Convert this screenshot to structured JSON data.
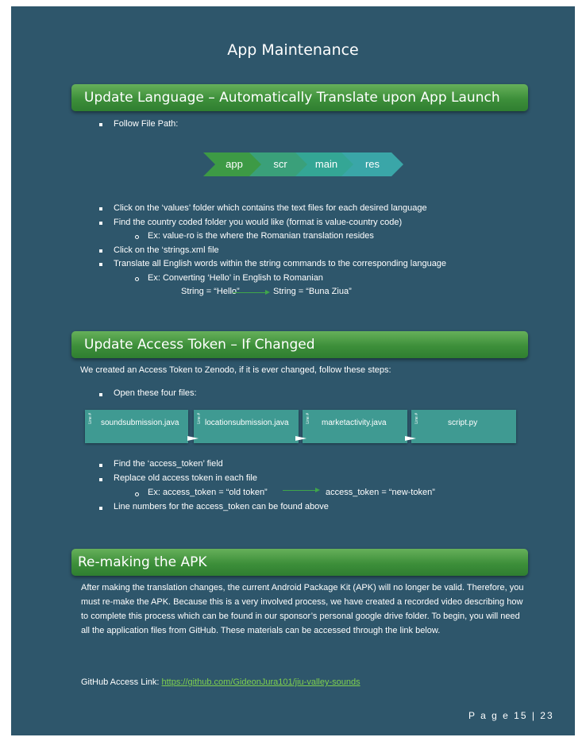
{
  "title": "App Maintenance",
  "section1": {
    "heading": "Update Language – Automatically Translate upon App Launch",
    "follow": "Follow File Path:",
    "path": [
      "app",
      "scr",
      "main",
      "res"
    ],
    "bullets": [
      "Click on the ‘values’ folder which contains the text files for each desired language",
      "Find the country coded folder you would like (format is value-country code)",
      "Click on the ‘strings.xml file",
      "Translate all English words within the string commands to the corresponding language"
    ],
    "sub1": "Ex: value-ro is the where the Romanian translation resides",
    "sub2": "Ex: Converting ‘Hello’ in English to Romanian",
    "string_from": "String = “Hello”",
    "string_to": "String = “Buna Ziua”"
  },
  "section2": {
    "heading": "Update Access Token – If Changed",
    "intro": "We created an Access Token to Zenodo, if it is ever changed, follow these steps:",
    "open": "Open these four files:",
    "files": [
      {
        "name": "soundsubmission.java",
        "line": "Line #"
      },
      {
        "name": "locationsubmission.java",
        "line": "Line #"
      },
      {
        "name": "marketactivity.java",
        "line": "Line #"
      },
      {
        "name": "script.py",
        "line": "Line #"
      }
    ],
    "bullets": [
      "Find the ‘access_token’ field",
      "Replace old access token in each file",
      "Line numbers for the access_token can be found above"
    ],
    "sub_prefix": "Ex: access_token = “old token”",
    "sub_result": "access_token = “new-token”"
  },
  "section3": {
    "heading": "Re-making the APK",
    "paragraph": "After making the translation changes, the current Android Package Kit (APK) will no longer be valid. Therefore, you must re-make the APK. Because this is a very involved process, we have created a recorded video describing how to complete this process which can be found in our sponsor’s personal google drive folder. To begin, you will need all the application files from GitHub. These materials can be accessed through the link below.",
    "link_label": "GitHub Access Link:",
    "link_url": "https://github.com/GideonJura101/jiu-valley-sounds"
  },
  "footer": {
    "page": "P a g e  15 | 23"
  },
  "colors": {
    "page_bg": "#2e566b",
    "banner_green": "#3d8f3a",
    "link_green": "#7fd04f",
    "box_teal": "#3f9a92"
  }
}
